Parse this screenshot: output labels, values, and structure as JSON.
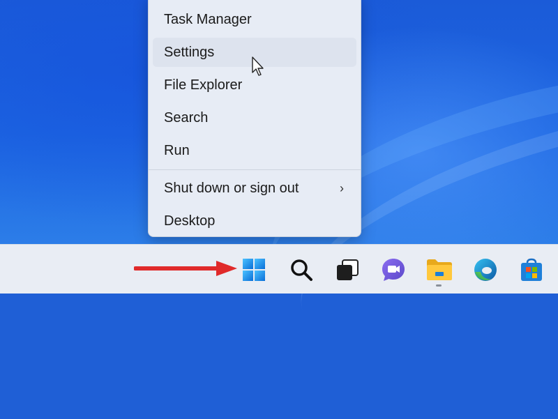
{
  "context_menu": {
    "items": [
      {
        "label": "Task Manager"
      },
      {
        "label": "Settings"
      },
      {
        "label": "File Explorer"
      },
      {
        "label": "Search"
      },
      {
        "label": "Run"
      },
      {
        "label": "Shut down or sign out",
        "submenu_icon": "chevron-right-icon"
      },
      {
        "label": "Desktop"
      }
    ],
    "hovered_item": "Settings"
  },
  "taskbar": {
    "icons": [
      {
        "name": "start-button",
        "icon": "windows-logo-icon"
      },
      {
        "name": "search-button",
        "icon": "magnifier-icon"
      },
      {
        "name": "task-view-button",
        "icon": "task-view-icon"
      },
      {
        "name": "chat-button",
        "icon": "teams-chat-icon"
      },
      {
        "name": "file-explorer-button",
        "icon": "folder-icon",
        "running": true
      },
      {
        "name": "edge-button",
        "icon": "edge-browser-icon"
      },
      {
        "name": "store-button",
        "icon": "microsoft-store-icon"
      }
    ]
  },
  "colors": {
    "accent_arrow": "#e02a2a",
    "windows_blue": "#1b8fe6",
    "menu_bg": "#e7ecf5",
    "taskbar_bg": "#e9edf4"
  }
}
